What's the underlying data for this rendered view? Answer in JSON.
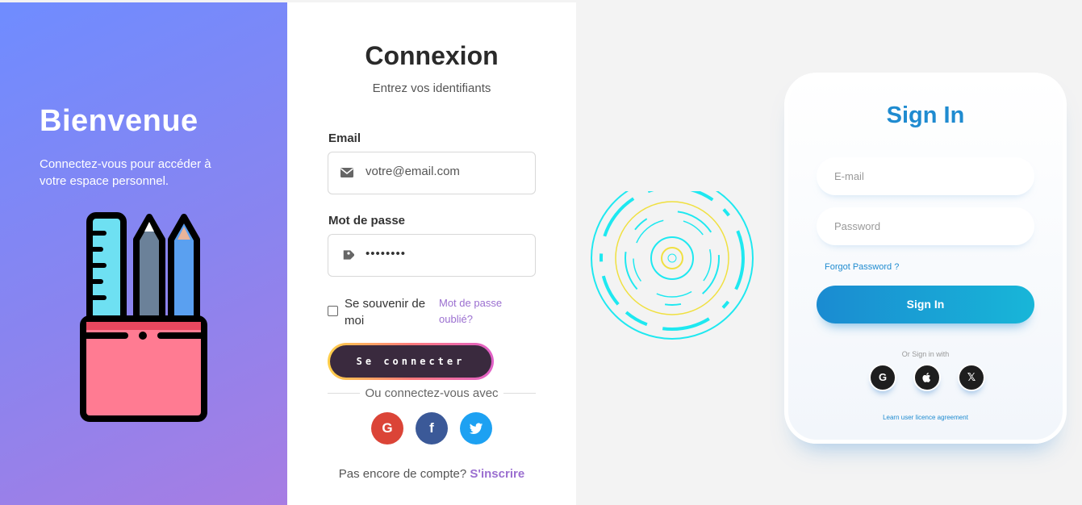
{
  "welcome": {
    "title": "Bienvenue",
    "subtitle": "Connectez-vous pour accéder à votre espace personnel."
  },
  "login": {
    "title": "Connexion",
    "subtitle": "Entrez vos identifiants",
    "email_label": "Email",
    "email_value": "votre@email.com",
    "password_label": "Mot de passe",
    "password_value": "••••••••",
    "remember_label": "Se souvenir de moi",
    "remember_checked": false,
    "forgot_label": "Mot de passe oublié?",
    "submit_label": "Se connecter",
    "divider_text": "Ou connectez-vous avec",
    "social": {
      "google": "G",
      "facebook": "f",
      "twitter": "t"
    },
    "signup_prompt": "Pas encore de compte?",
    "signup_link": "S'inscrire"
  },
  "signin": {
    "title": "Sign In",
    "email_placeholder": "E-mail",
    "password_placeholder": "Password",
    "forgot_label": "Forgot Password ?",
    "button_label": "Sign In",
    "or_text": "Or Sign in with",
    "social": {
      "google": "G",
      "apple": "",
      "x": "𝕏"
    },
    "licence_link": "Learn user licence agreement"
  },
  "colors": {
    "left_gradient_start": "#6f8cff",
    "left_gradient_end": "#a77de3",
    "accent_purple": "#9b6fd0",
    "signin_blue": "#1f8bd0",
    "spinner_cyan": "#1ee8f0",
    "spinner_yellow": "#f0e040",
    "google_red": "#db4437",
    "facebook_blue": "#3b5998",
    "twitter_blue": "#1da1f2"
  },
  "icons": {
    "email": "envelope-icon",
    "password": "tag-icon",
    "illustration": "pencil-cup-illustration",
    "loader": "circular-loader"
  }
}
